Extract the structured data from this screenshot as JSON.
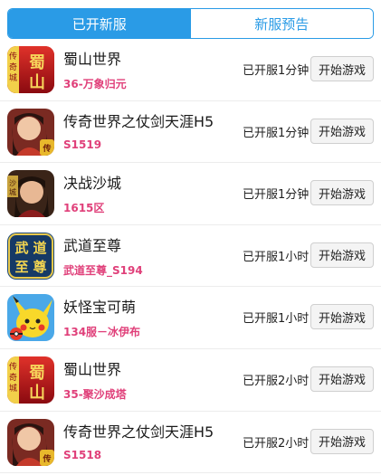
{
  "tabs": {
    "opened": "已开新服",
    "upcoming": "新服预告"
  },
  "games": [
    {
      "name": "蜀山世界",
      "server": "36-万象归元",
      "time": "已开服1分钟",
      "button": "开始游戏",
      "icon": "shushan-game-icon",
      "badge": "传奇城",
      "art": "蜀山"
    },
    {
      "name": "传奇世界之仗剑天涯H5",
      "server": "S1519",
      "time": "已开服1分钟",
      "button": "开始游戏",
      "icon": "chuanqi-game-icon",
      "badge": "传奇",
      "art": ""
    },
    {
      "name": "决战沙城",
      "server": "1615区",
      "time": "已开服1分钟",
      "button": "开始游戏",
      "icon": "shacheng-game-icon",
      "badge": "",
      "art": ""
    },
    {
      "name": "武道至尊",
      "server": "武道至尊_S194",
      "time": "已开服1小时",
      "button": "开始游戏",
      "icon": "wudao-game-icon",
      "badge": "",
      "art": "武道至尊"
    },
    {
      "name": "妖怪宝可萌",
      "server": "134服－冰伊布",
      "time": "已开服1小时",
      "button": "开始游戏",
      "icon": "pokemon-game-icon",
      "badge": "",
      "art": ""
    },
    {
      "name": "蜀山世界",
      "server": "35-聚沙成塔",
      "time": "已开服2小时",
      "button": "开始游戏",
      "icon": "shushan-game-icon",
      "badge": "传奇城",
      "art": "蜀山"
    },
    {
      "name": "传奇世界之仗剑天涯H5",
      "server": "S1518",
      "time": "已开服2小时",
      "button": "开始游戏",
      "icon": "chuanqi-game-icon",
      "badge": "传奇",
      "art": ""
    }
  ]
}
